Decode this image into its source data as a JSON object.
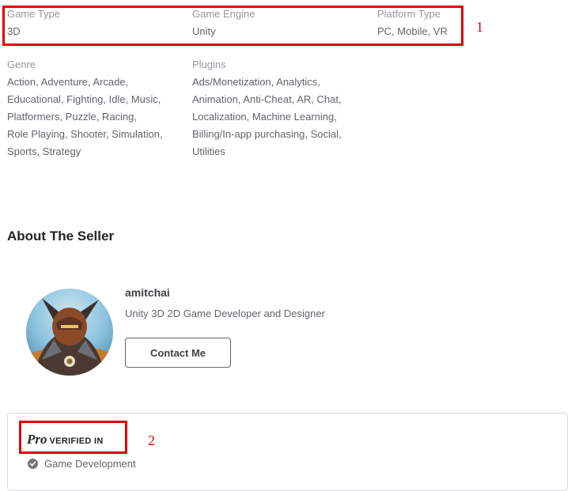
{
  "attributes": {
    "game_type": {
      "label": "Game Type",
      "value": "3D"
    },
    "game_engine": {
      "label": "Game Engine",
      "value": "Unity"
    },
    "platform_type": {
      "label": "Platform Type",
      "value": "PC, Mobile, VR"
    },
    "genre": {
      "label": "Genre",
      "lines": [
        "Action, Adventure, Arcade,",
        "Educational, Fighting, Idle, Music,",
        "Platformers, Puzzle, Racing,",
        "Role Playing, Shooter, Simulation,",
        "Sports, Strategy"
      ]
    },
    "plugins": {
      "label": "Plugins",
      "lines": [
        "Ads/Monetization, Analytics,",
        "Animation, Anti-Cheat, AR, Chat,",
        "Localization, Machine Learning,",
        "Billing/In-app purchasing, Social,",
        "Utilities"
      ]
    }
  },
  "annotations": {
    "one": "1",
    "two": "2"
  },
  "seller": {
    "section_title": "About The Seller",
    "name": "amitchai",
    "tagline": "Unity 3D 2D Game Developer and Designer",
    "contact_label": "Contact Me",
    "avatar_icon": "warrior-avatar"
  },
  "pro": {
    "logo": "Pro",
    "verified_label": "VERIFIED IN",
    "category": "Game Development",
    "check_icon": "check-circle-icon"
  }
}
